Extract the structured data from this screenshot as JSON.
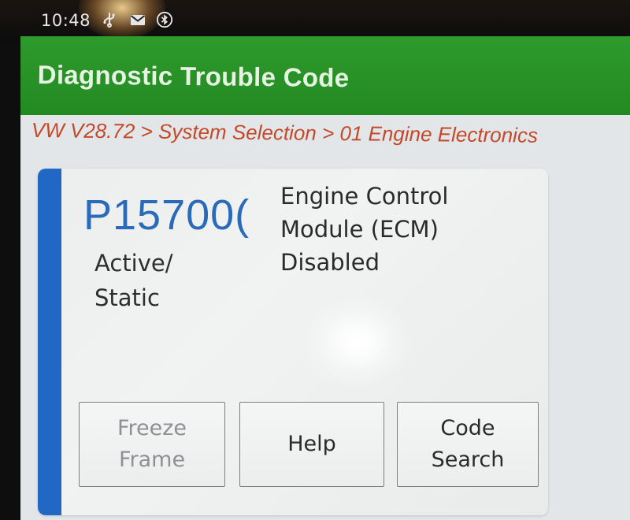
{
  "status_bar": {
    "time": "10:48",
    "icons": [
      "usb-icon",
      "mail-icon",
      "bluetooth-icon"
    ]
  },
  "app": {
    "title": "Diagnostic Trouble Code",
    "breadcrumb": "VW V28.72 > System Selection > 01 Engine Electronics"
  },
  "dtc": {
    "code": "P15700(",
    "status_line1": "Active/",
    "status_line2": "Static",
    "description_line1": "Engine Control",
    "description_line2": "Module (ECM)",
    "description_line3": "Disabled"
  },
  "buttons": {
    "freeze_frame_line1": "Freeze",
    "freeze_frame_line2": "Frame",
    "help": "Help",
    "code_search_line1": "Code",
    "code_search_line2": "Search"
  },
  "colors": {
    "title_bar": "#238a22",
    "breadcrumb": "#c24a2a",
    "accent": "#2168c4",
    "code": "#2a6ab8"
  }
}
